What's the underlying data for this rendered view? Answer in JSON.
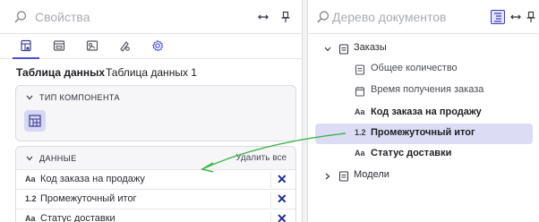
{
  "colors": {
    "accent": "#4b4fd6",
    "selection": "#dcdcf5",
    "arrow": "#3db54a",
    "delete": "#1e2a8a"
  },
  "left_panel": {
    "search": {
      "placeholder": "Свойства",
      "icons": [
        "search-icon",
        "swap-horizontal-icon",
        "pin-icon"
      ]
    },
    "tabs": [
      {
        "icon": "data-table-icon",
        "active": true
      },
      {
        "icon": "component-icon",
        "active": false
      },
      {
        "icon": "image-settings-icon",
        "active": false
      },
      {
        "icon": "style-icon",
        "active": false
      },
      {
        "icon": "gear-icon",
        "active": false
      }
    ],
    "datasets": {
      "active": "Таблица данных",
      "other": "Таблица данных 1"
    },
    "type_section": {
      "title": "ТИП КОМПОНЕНТА",
      "icon": "table-component-icon"
    },
    "data_section": {
      "title": "ДАННЫЕ",
      "action": "Удалить все",
      "rows": [
        {
          "type_icon": "Aa",
          "label": "Код заказа на продажу",
          "delete": "✕"
        },
        {
          "type_icon": "1.2",
          "label": "Промежуточный итог",
          "delete": "✕"
        },
        {
          "type_icon": "Aa",
          "label": "Статус доставки",
          "delete": "✕"
        }
      ]
    }
  },
  "right_panel": {
    "search": {
      "placeholder": "Дерево документов",
      "icons": [
        "search-icon",
        "tree-view-icon",
        "swap-horizontal-icon",
        "pin-icon"
      ]
    },
    "tree": {
      "orders": {
        "label": "Заказы",
        "children": [
          {
            "type_icon": "document-icon",
            "label": "Общее количество"
          },
          {
            "type_icon": "calendar-icon",
            "label": "Время получения заказа"
          },
          {
            "type_icon": "Aa",
            "label": "Код заказа на продажу"
          },
          {
            "type_icon": "1.2",
            "label": "Промежуточный итог",
            "selected": true
          },
          {
            "type_icon": "Aa",
            "label": "Статус доставки"
          }
        ]
      },
      "models": {
        "label": "Модели"
      }
    }
  }
}
